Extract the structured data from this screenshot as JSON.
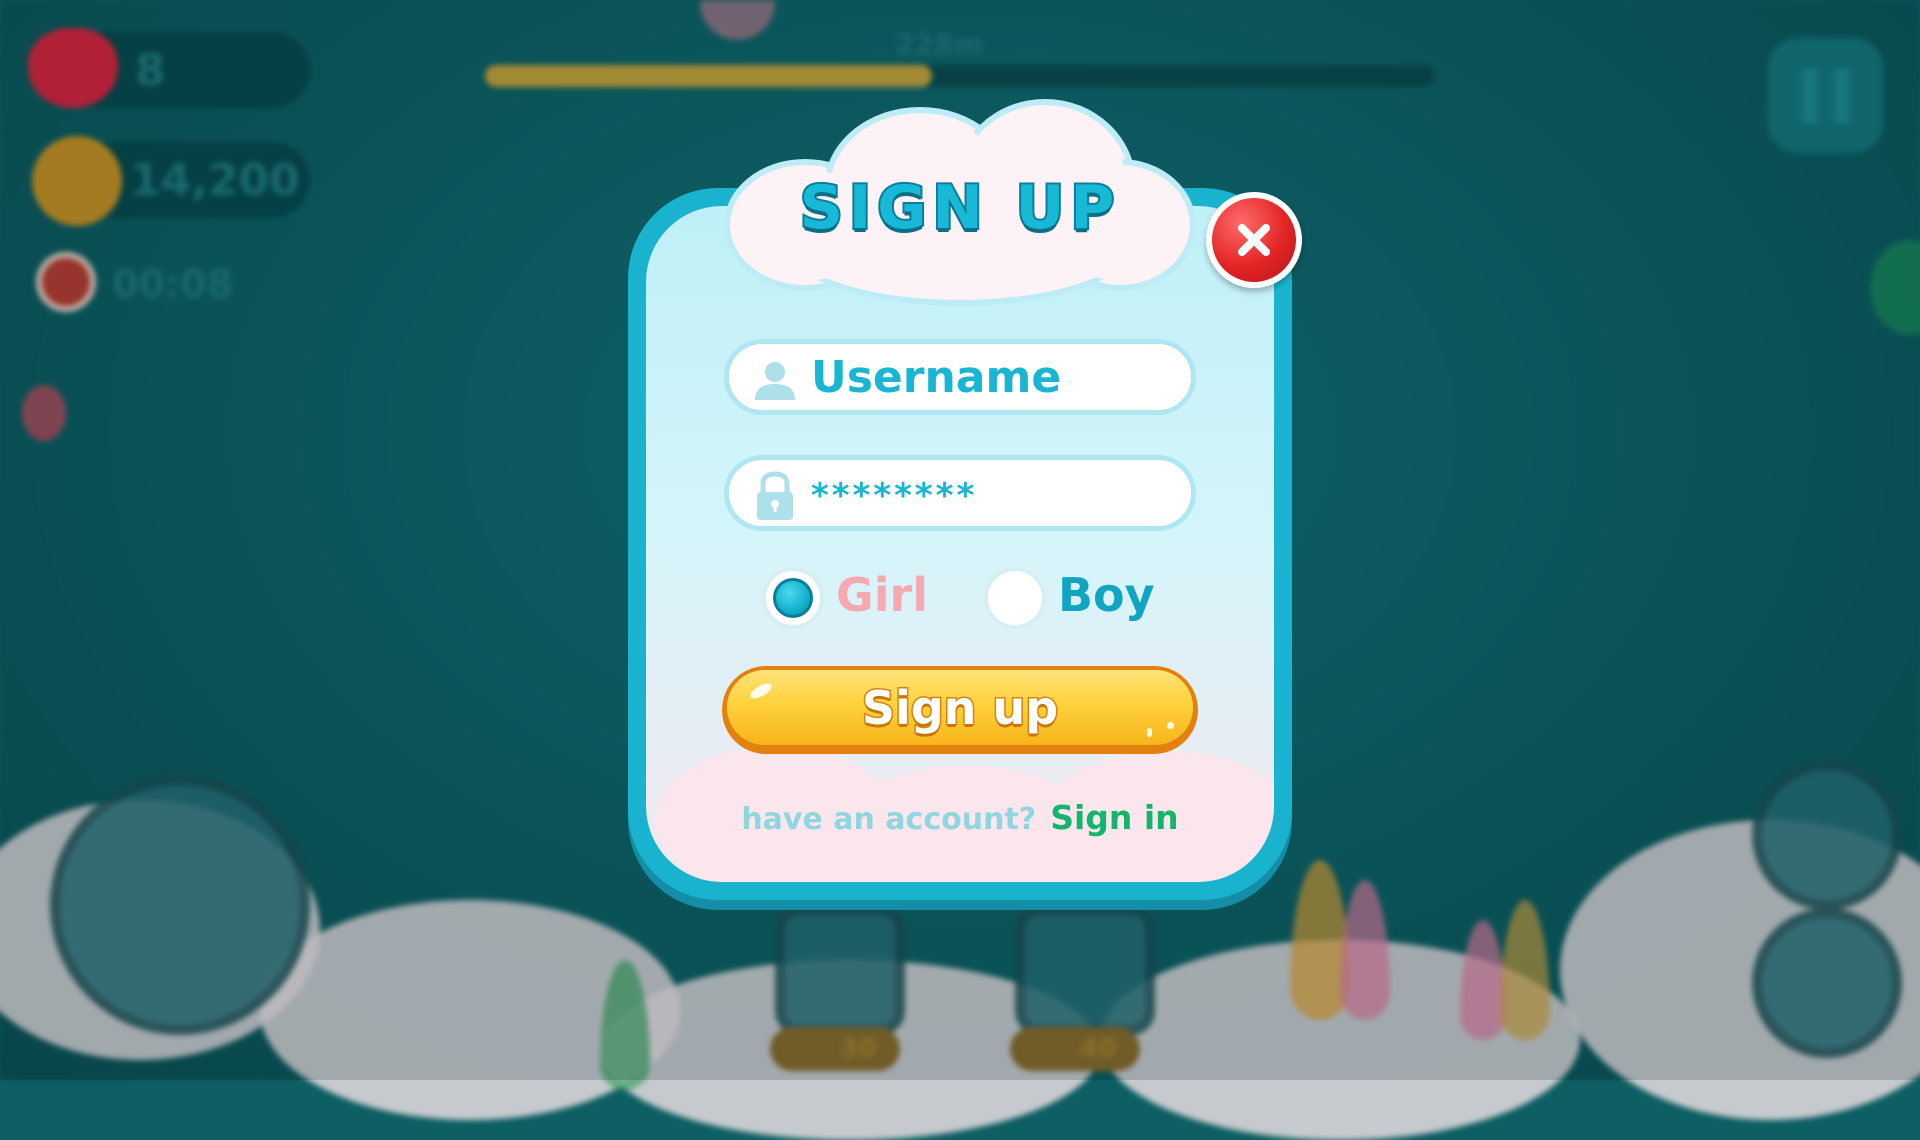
{
  "hud": {
    "lives": "8",
    "coins": "14,200",
    "timer": "00:08",
    "distance": "228m",
    "progress": 0.47
  },
  "shop": {
    "item1_price": "30",
    "item2_price": "40"
  },
  "dialog": {
    "title": "SIGN UP",
    "username_placeholder": "Username",
    "password_value": "********",
    "gender_options": [
      "Girl",
      "Boy"
    ],
    "selected_gender": "Girl",
    "submit_label": "Sign up",
    "footer_prompt": "have an account?",
    "footer_link": "Sign in"
  },
  "colors": {
    "accent": "#18b9d6",
    "close_red": "#e32424",
    "button_yellow": "#ffd23c",
    "girl_pink": "#f6a9b0",
    "boy_teal": "#12a5c3",
    "link_green": "#12b46e"
  },
  "icons": {
    "close": "close-icon",
    "username": "user-icon",
    "password": "lock-icon",
    "pause": "pause-icon",
    "heart": "heart-icon",
    "coin": "coin-icon",
    "clock": "clock-icon"
  }
}
